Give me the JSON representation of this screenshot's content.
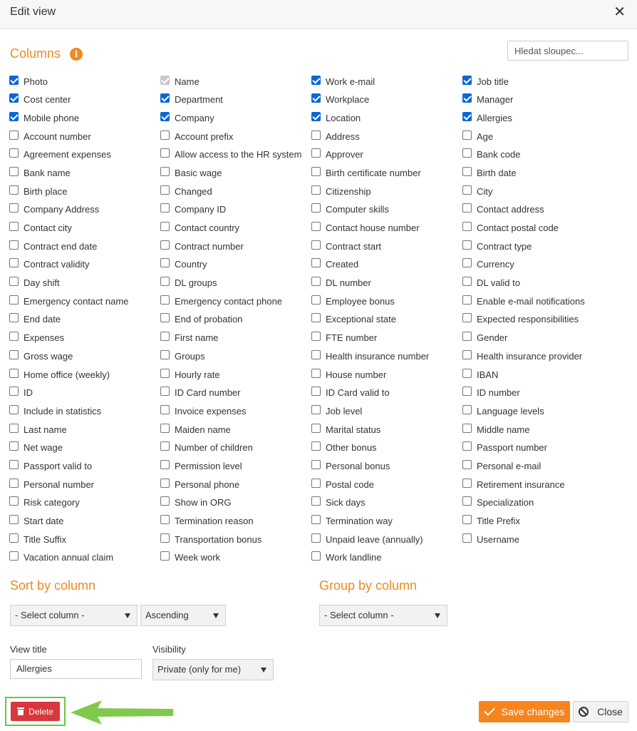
{
  "dialog": {
    "title": "Edit view",
    "close_glyph": "✕"
  },
  "columns": {
    "title": "Columns",
    "info_glyph": "i",
    "search_placeholder": "Hledat sloupec...",
    "rows": [
      [
        {
          "label": "Photo",
          "state": "checked"
        },
        {
          "label": "Name",
          "state": "disabled"
        },
        {
          "label": "Work e-mail",
          "state": "checked"
        },
        {
          "label": "Job title",
          "state": "checked"
        }
      ],
      [
        {
          "label": "Cost center",
          "state": "checked"
        },
        {
          "label": "Department",
          "state": "checked"
        },
        {
          "label": "Workplace",
          "state": "checked"
        },
        {
          "label": "Manager",
          "state": "checked"
        }
      ],
      [
        {
          "label": "Mobile phone",
          "state": "checked"
        },
        {
          "label": "Company",
          "state": "checked"
        },
        {
          "label": "Location",
          "state": "checked"
        },
        {
          "label": "Allergies",
          "state": "checked"
        }
      ],
      [
        {
          "label": "Account number",
          "state": "unchecked"
        },
        {
          "label": "Account prefix",
          "state": "unchecked"
        },
        {
          "label": "Address",
          "state": "unchecked"
        },
        {
          "label": "Age",
          "state": "unchecked"
        }
      ],
      [
        {
          "label": "Agreement expenses",
          "state": "unchecked"
        },
        {
          "label": "Allow access to the HR system",
          "state": "unchecked"
        },
        {
          "label": "Approver",
          "state": "unchecked"
        },
        {
          "label": "Bank code",
          "state": "unchecked"
        }
      ],
      [
        {
          "label": "Bank name",
          "state": "unchecked"
        },
        {
          "label": "Basic wage",
          "state": "unchecked"
        },
        {
          "label": "Birth certificate number",
          "state": "unchecked"
        },
        {
          "label": "Birth date",
          "state": "unchecked"
        }
      ],
      [
        {
          "label": "Birth place",
          "state": "unchecked"
        },
        {
          "label": "Changed",
          "state": "unchecked"
        },
        {
          "label": "Citizenship",
          "state": "unchecked"
        },
        {
          "label": "City",
          "state": "unchecked"
        }
      ],
      [
        {
          "label": "Company Address",
          "state": "unchecked"
        },
        {
          "label": "Company ID",
          "state": "unchecked"
        },
        {
          "label": "Computer skills",
          "state": "unchecked"
        },
        {
          "label": "Contact address",
          "state": "unchecked"
        }
      ],
      [
        {
          "label": "Contact city",
          "state": "unchecked"
        },
        {
          "label": "Contact country",
          "state": "unchecked"
        },
        {
          "label": "Contact house number",
          "state": "unchecked"
        },
        {
          "label": "Contact postal code",
          "state": "unchecked"
        }
      ],
      [
        {
          "label": "Contract end date",
          "state": "unchecked"
        },
        {
          "label": "Contract number",
          "state": "unchecked"
        },
        {
          "label": "Contract start",
          "state": "unchecked"
        },
        {
          "label": "Contract type",
          "state": "unchecked"
        }
      ],
      [
        {
          "label": "Contract validity",
          "state": "unchecked"
        },
        {
          "label": "Country",
          "state": "unchecked"
        },
        {
          "label": "Created",
          "state": "unchecked"
        },
        {
          "label": "Currency",
          "state": "unchecked"
        }
      ],
      [
        {
          "label": "Day shift",
          "state": "unchecked"
        },
        {
          "label": "DL groups",
          "state": "unchecked"
        },
        {
          "label": "DL number",
          "state": "unchecked"
        },
        {
          "label": "DL valid to",
          "state": "unchecked"
        }
      ],
      [
        {
          "label": "Emergency contact name",
          "state": "unchecked"
        },
        {
          "label": "Emergency contact phone",
          "state": "unchecked"
        },
        {
          "label": "Employee bonus",
          "state": "unchecked"
        },
        {
          "label": "Enable e-mail notifications",
          "state": "unchecked"
        }
      ],
      [
        {
          "label": "End date",
          "state": "unchecked"
        },
        {
          "label": "End of probation",
          "state": "unchecked"
        },
        {
          "label": "Exceptional state",
          "state": "unchecked"
        },
        {
          "label": "Expected responsibilities",
          "state": "unchecked"
        }
      ],
      [
        {
          "label": "Expenses",
          "state": "unchecked"
        },
        {
          "label": "First name",
          "state": "unchecked"
        },
        {
          "label": "FTE number",
          "state": "unchecked"
        },
        {
          "label": "Gender",
          "state": "unchecked"
        }
      ],
      [
        {
          "label": "Gross wage",
          "state": "unchecked"
        },
        {
          "label": "Groups",
          "state": "unchecked"
        },
        {
          "label": "Health insurance number",
          "state": "unchecked"
        },
        {
          "label": "Health insurance provider",
          "state": "unchecked"
        }
      ],
      [
        {
          "label": "Home office (weekly)",
          "state": "unchecked"
        },
        {
          "label": "Hourly rate",
          "state": "unchecked"
        },
        {
          "label": "House number",
          "state": "unchecked"
        },
        {
          "label": "IBAN",
          "state": "unchecked"
        }
      ],
      [
        {
          "label": "ID",
          "state": "unchecked"
        },
        {
          "label": "ID Card number",
          "state": "unchecked"
        },
        {
          "label": "ID Card valid to",
          "state": "unchecked"
        },
        {
          "label": "ID number",
          "state": "unchecked"
        }
      ],
      [
        {
          "label": "Include in statistics",
          "state": "unchecked"
        },
        {
          "label": "Invoice expenses",
          "state": "unchecked"
        },
        {
          "label": "Job level",
          "state": "unchecked"
        },
        {
          "label": "Language levels",
          "state": "unchecked"
        }
      ],
      [
        {
          "label": "Last name",
          "state": "unchecked"
        },
        {
          "label": "Maiden name",
          "state": "unchecked"
        },
        {
          "label": "Marital status",
          "state": "unchecked"
        },
        {
          "label": "Middle name",
          "state": "unchecked"
        }
      ],
      [
        {
          "label": "Net wage",
          "state": "unchecked"
        },
        {
          "label": "Number of children",
          "state": "unchecked"
        },
        {
          "label": "Other bonus",
          "state": "unchecked"
        },
        {
          "label": "Passport number",
          "state": "unchecked"
        }
      ],
      [
        {
          "label": "Passport valid to",
          "state": "unchecked"
        },
        {
          "label": "Permission level",
          "state": "unchecked"
        },
        {
          "label": "Personal bonus",
          "state": "unchecked"
        },
        {
          "label": "Personal e-mail",
          "state": "unchecked"
        }
      ],
      [
        {
          "label": "Personal number",
          "state": "unchecked"
        },
        {
          "label": "Personal phone",
          "state": "unchecked"
        },
        {
          "label": "Postal code",
          "state": "unchecked"
        },
        {
          "label": "Retirement insurance",
          "state": "unchecked"
        }
      ],
      [
        {
          "label": "Risk category",
          "state": "unchecked"
        },
        {
          "label": "Show in ORG",
          "state": "unchecked"
        },
        {
          "label": "Sick days",
          "state": "unchecked"
        },
        {
          "label": "Specialization",
          "state": "unchecked"
        }
      ],
      [
        {
          "label": "Start date",
          "state": "unchecked"
        },
        {
          "label": "Termination reason",
          "state": "unchecked"
        },
        {
          "label": "Termination way",
          "state": "unchecked"
        },
        {
          "label": "Title Prefix",
          "state": "unchecked"
        }
      ],
      [
        {
          "label": "Title Suffix",
          "state": "unchecked"
        },
        {
          "label": "Transportation bonus",
          "state": "unchecked"
        },
        {
          "label": "Unpaid leave (annually)",
          "state": "unchecked"
        },
        {
          "label": "Username",
          "state": "unchecked"
        }
      ],
      [
        {
          "label": "Vacation annual claim",
          "state": "unchecked"
        },
        {
          "label": "Week work",
          "state": "unchecked"
        },
        {
          "label": "Work landline",
          "state": "unchecked"
        }
      ]
    ]
  },
  "sort": {
    "title": "Sort by column",
    "column_value": "- Select column -",
    "order_value": "Ascending"
  },
  "group": {
    "title": "Group by column",
    "column_value": "- Select column -"
  },
  "view_title": {
    "label": "View title",
    "value": "Allergies"
  },
  "visibility": {
    "label": "Visibility",
    "value": "Private (only for me)"
  },
  "footer": {
    "delete_label": "Delete",
    "save_label": "Save changes",
    "close_label": "Close"
  },
  "colors": {
    "accent_orange": "#f08a24",
    "save_orange": "#f7841c",
    "delete_red": "#d9363e",
    "checkbox_blue": "#0b67d6",
    "highlight_green": "#72c33a"
  }
}
